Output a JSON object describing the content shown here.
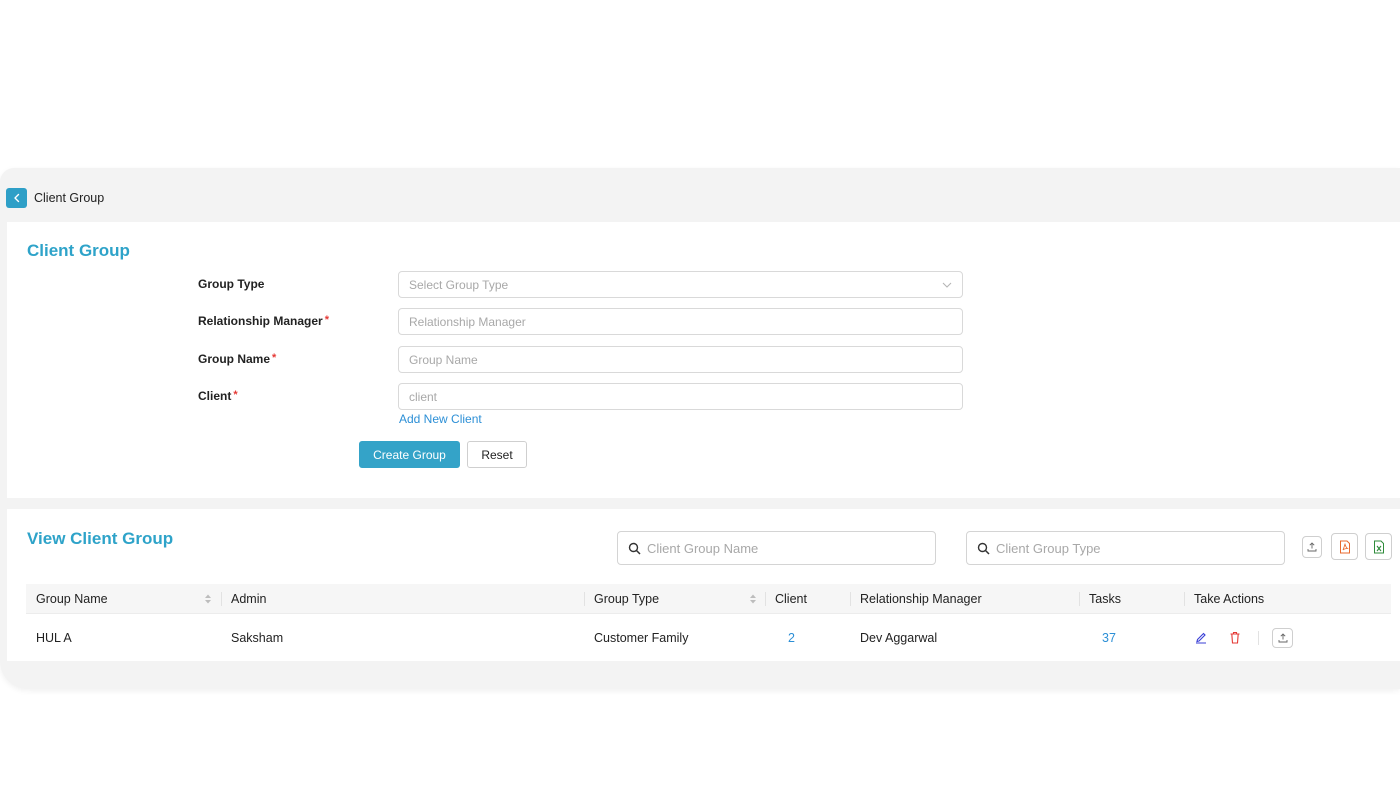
{
  "breadcrumb": {
    "title": "Client Group"
  },
  "form": {
    "title": "Client Group",
    "fields": [
      {
        "label": "Group Type",
        "required": false,
        "placeholder": "Select Group Type",
        "value": ""
      },
      {
        "label": "Relationship Manager",
        "required": true,
        "placeholder": "Relationship Manager",
        "value": ""
      },
      {
        "label": "Group Name",
        "required": true,
        "placeholder": "Group Name",
        "value": ""
      },
      {
        "label": "Client",
        "required": true,
        "placeholder": "client",
        "value": ""
      }
    ],
    "required_mark": "*",
    "add_client_link": "Add New Client",
    "create_button": "Create Group",
    "reset_button": "Reset"
  },
  "list": {
    "title": "View Client Group",
    "search_name_placeholder": "Client Group Name",
    "search_type_placeholder": "Client Group Type",
    "columns": [
      "Group Name",
      "Admin",
      "Group Type",
      "Client",
      "Relationship Manager",
      "Tasks",
      "Take Actions"
    ],
    "rows": [
      {
        "group_name": "HUL A",
        "admin": "Saksham",
        "group_type": "Customer Family",
        "client": "2",
        "relationship_manager": "Dev Aggarwal",
        "tasks": "37"
      }
    ]
  },
  "colors": {
    "accent": "#2ea3c9",
    "link": "#2c8fd6",
    "delete": "#e53935",
    "edit": "#3a3fd6",
    "pdf": "#e8692c",
    "excel": "#2e8b3a"
  },
  "icons": [
    "chevron-left-icon",
    "chevron-down-icon",
    "search-icon",
    "sort-icon",
    "upload-icon",
    "pdf-icon",
    "excel-icon",
    "edit-icon",
    "delete-icon"
  ]
}
